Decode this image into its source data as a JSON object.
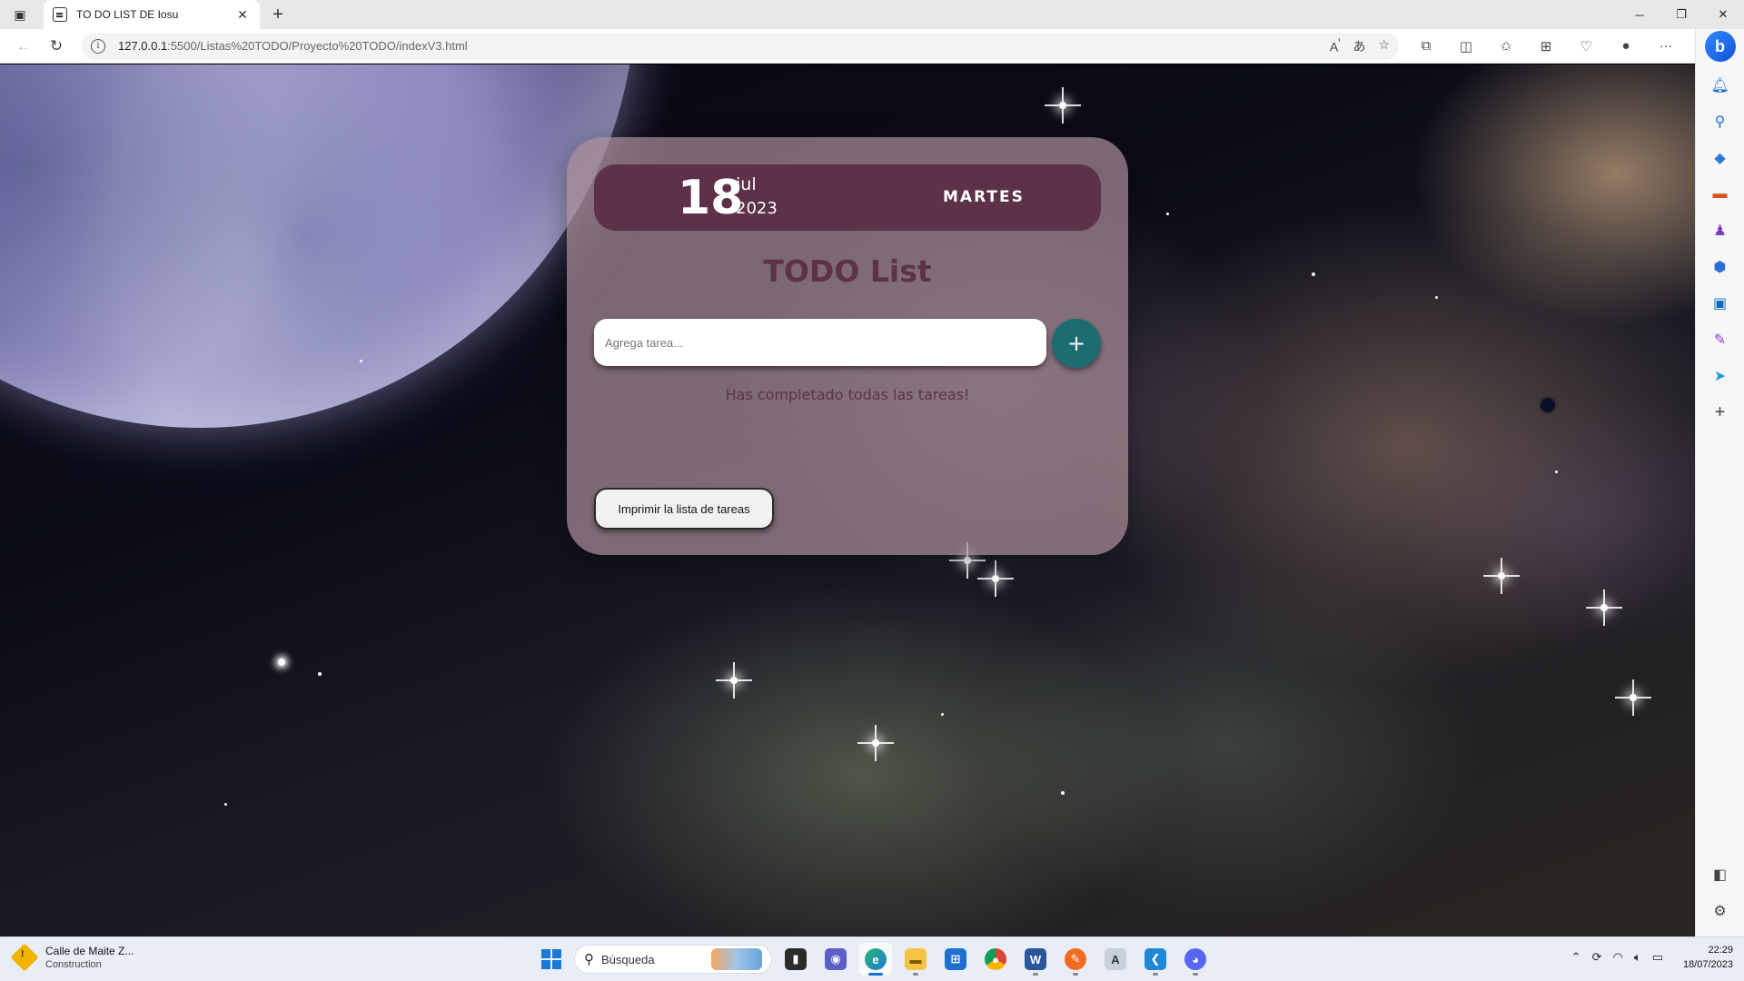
{
  "browser": {
    "tab_title": "TO DO LIST DE Iosu",
    "url_host": "127.0.0.1",
    "url_rest": ":5500/Listas%20TODO/Proyecto%20TODO/indexV3.html"
  },
  "icons": {
    "back": "arrow-left",
    "refresh": "refresh",
    "info": "info",
    "read_aloud": "read-aloud",
    "translate": "translate",
    "favorite": "star",
    "extensions": "puzzle",
    "split": "split-screen",
    "favorites_bar": "favorites",
    "collections": "collections",
    "browser_essentials": "heart-shield",
    "profile": "person",
    "more": "more-dots"
  },
  "sidebar_items": [
    "bing",
    "bell",
    "search",
    "shopping",
    "tools",
    "games",
    "microsoft-365",
    "outlook",
    "designer",
    "drop",
    "add"
  ],
  "todo": {
    "day": "18",
    "month": "jul",
    "year": "2023",
    "weekday": "MARTES",
    "title": "TODO List",
    "input_placeholder": "Agrega tarea...",
    "add_label": "+",
    "completed_message": "Has completado todas las tareas!",
    "print_label": "Imprimir la lista de tareas",
    "colors": {
      "date_bar": "#5d3148",
      "accent_teal": "#1c6d72",
      "title": "#5d3148"
    }
  },
  "taskbar": {
    "weather_title": "Calle de Maite Z...",
    "weather_subtitle": "Construction",
    "search_placeholder": "Búsqueda",
    "apps": [
      "file-manager",
      "teams-chat",
      "edge",
      "file-explorer",
      "microsoft-store",
      "chrome",
      "word",
      "pencil-app",
      "translator",
      "vscode",
      "discord"
    ],
    "time": "22:29",
    "date": "18/07/2023"
  }
}
